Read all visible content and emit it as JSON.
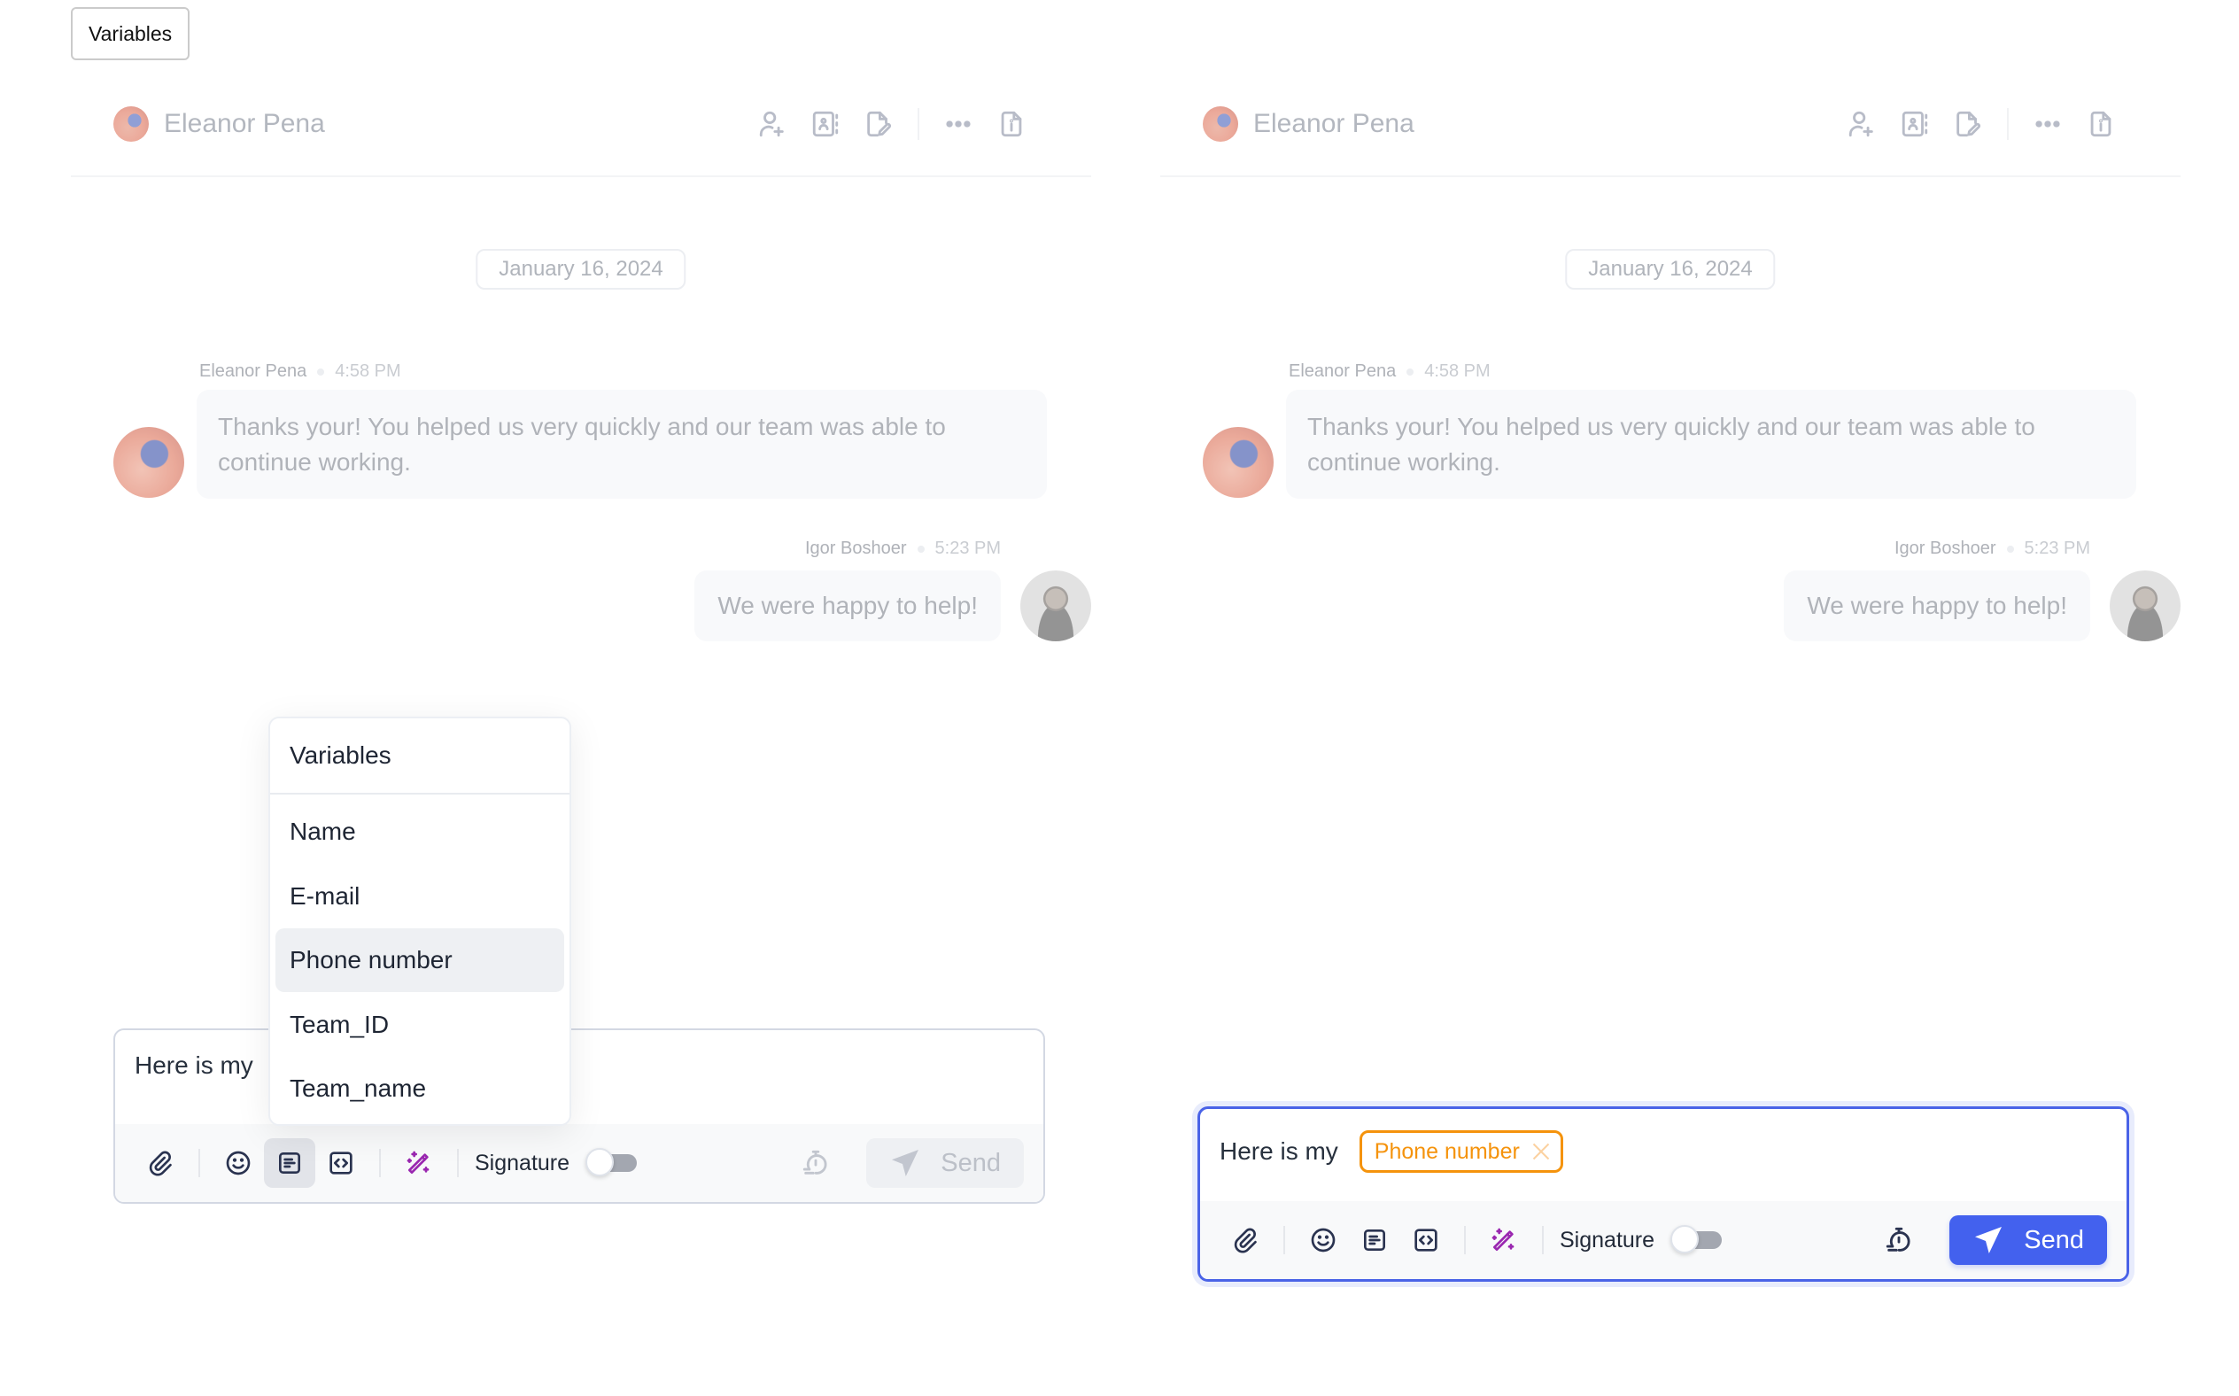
{
  "top_label": "Variables",
  "panels": {
    "left": {
      "header": {
        "contact_name": "Eleanor Pena"
      },
      "date_divider": "January 16, 2024",
      "messages": [
        {
          "author": "Eleanor Pena",
          "time": "4:58 PM",
          "text": "Thanks your! You helped us very quickly and our team was able to continue working.",
          "direction": "incoming"
        },
        {
          "author": "Igor Boshoer",
          "time": "5:23 PM",
          "text": "We were happy to help!",
          "direction": "outgoing"
        }
      ],
      "composer": {
        "text": "Here is my",
        "signature_label": "Signature",
        "signature_enabled": false,
        "send_label": "Send",
        "send_enabled": false,
        "variables_button_active": true
      },
      "variables_menu": {
        "title": "Variables",
        "items": [
          "Name",
          "E-mail",
          "Phone number",
          "Team_ID",
          "Team_name"
        ],
        "highlighted": "Phone number"
      }
    },
    "right": {
      "header": {
        "contact_name": "Eleanor Pena"
      },
      "date_divider": "January 16, 2024",
      "messages": [
        {
          "author": "Eleanor Pena",
          "time": "4:58 PM",
          "text": "Thanks your! You helped us very quickly and our team was able to continue working.",
          "direction": "incoming"
        },
        {
          "author": "Igor Boshoer",
          "time": "5:23 PM",
          "text": "We were happy to help!",
          "direction": "outgoing"
        }
      ],
      "composer": {
        "text": "Here is my",
        "variable_chip": "Phone number",
        "signature_label": "Signature",
        "signature_enabled": false,
        "send_label": "Send",
        "send_enabled": true,
        "focused": true
      }
    }
  },
  "header_actions": [
    "user-plus-icon",
    "contact-book-icon",
    "file-edit-icon",
    "more-icon",
    "file-info-icon"
  ],
  "colors": {
    "accent": "#4361ee",
    "variable_chip": "#f5930c",
    "magic_icon": "#9a27b0",
    "muted_text": "#b0b3b9"
  }
}
